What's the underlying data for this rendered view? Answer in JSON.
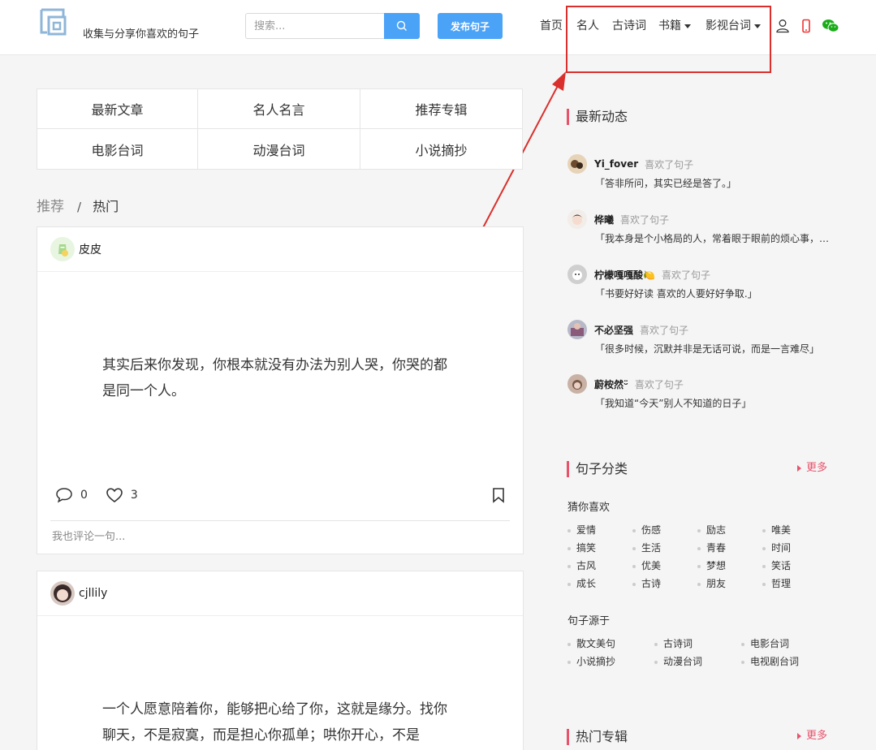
{
  "header": {
    "tagline": "收集与分享你喜欢的句子",
    "search": {
      "placeholder": "搜索..."
    },
    "publish_label": "发布句子",
    "nav": [
      {
        "label": "首页"
      },
      {
        "label": "名人"
      },
      {
        "label": "古诗词"
      },
      {
        "label": "书籍"
      },
      {
        "label": "影视台词"
      }
    ],
    "icons": [
      "user-icon",
      "phone-icon",
      "wechat-icon"
    ]
  },
  "colors": {
    "accent": "#4aa3f7",
    "sidebar_accent": "#e8536c",
    "annotation": "#d9302d",
    "wechat": "#1aad19",
    "phone": "#e33"
  },
  "categories": [
    "最新文章",
    "名人名言",
    "推荐专辑",
    "电影台词",
    "动漫台词",
    "小说摘抄"
  ],
  "tabs": {
    "recommend": "推荐",
    "separator": "/",
    "hot": "热门"
  },
  "posts": [
    {
      "user": "皮皮",
      "text": "其实后来你发现，你根本就没有办法为别人哭，你哭的都是同一个人。",
      "comments": "0",
      "likes": "3",
      "comment_placeholder": "我也评论一句..."
    },
    {
      "user": "cjllily",
      "text": "一个人愿意陪着你，能够把心给了你，这就是缘分。找你聊天，不是寂寞，而是担心你孤单；哄你开心，不是"
    }
  ],
  "sidebar": {
    "feed_title": "最新动态",
    "feed": [
      {
        "user": "Yi_fover",
        "action": "喜欢了句子",
        "quote": "「答非所问，其实已经是答了。」"
      },
      {
        "user": "桦曦",
        "action": "喜欢了句子",
        "quote": "「我本身是个小格局的人，常着眼于眼前的烦心事，总是放大生活中的不如意」"
      },
      {
        "user": "柠檬嘎嘎酸🍋",
        "action": "喜欢了句子",
        "quote": "「书要好好读 喜欢的人要好好争取.」"
      },
      {
        "user": "不必坚强",
        "action": "喜欢了句子",
        "quote": "「很多时候，沉默并非是无话可说，而是一言难尽」"
      },
      {
        "user": "蔚桉然ᵕ̈",
        "action": "喜欢了句子",
        "quote": "「我知道“今天”别人不知道的日子」"
      }
    ],
    "category_title": "句子分类",
    "more_label": "更多",
    "guess_title": "猜你喜欢",
    "guess_tags": [
      "爱情",
      "伤感",
      "励志",
      "唯美",
      "搞笑",
      "生活",
      "青春",
      "时间",
      "古风",
      "优美",
      "梦想",
      "笑话",
      "成长",
      "古诗",
      "朋友",
      "哲理"
    ],
    "source_title": "句子源于",
    "source_tags": [
      "散文美句",
      "古诗词",
      "电影台词",
      "小说摘抄",
      "动漫台词",
      "电视剧台词"
    ],
    "album_title": "热门专辑"
  }
}
